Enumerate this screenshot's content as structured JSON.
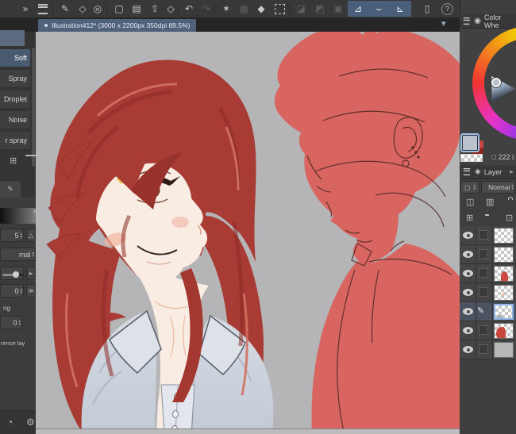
{
  "toolbar": {
    "icons": [
      {
        "name": "panel-overflow",
        "glyph": "»"
      },
      {
        "name": "main-menu",
        "glyph": ""
      },
      {
        "name": "edit-in-app",
        "glyph": "✎"
      },
      {
        "name": "window-size",
        "glyph": "◇"
      },
      {
        "name": "clip-studio-home",
        "glyph": "◎"
      },
      {
        "name": "new-file",
        "glyph": "▢"
      },
      {
        "name": "open-file",
        "glyph": "▤"
      },
      {
        "name": "save-file",
        "glyph": "⇧"
      },
      {
        "name": "export",
        "glyph": "◇"
      },
      {
        "name": "undo",
        "glyph": "↶"
      },
      {
        "name": "redo",
        "glyph": "↷"
      },
      {
        "name": "clear",
        "glyph": "✶"
      },
      {
        "name": "grid",
        "glyph": "▦"
      },
      {
        "name": "fill",
        "glyph": "◆"
      },
      {
        "name": "transform-frame",
        "glyph": ""
      },
      {
        "name": "select-area",
        "glyph": "◪"
      },
      {
        "name": "deselect",
        "glyph": "◩"
      },
      {
        "name": "invert-selection",
        "glyph": "▣"
      },
      {
        "name": "snap-to-ruler",
        "glyph": "⊿"
      },
      {
        "name": "snap-to-special-ruler",
        "glyph": "⌣"
      },
      {
        "name": "snap-to-grid",
        "glyph": "⊾"
      },
      {
        "name": "companion-mode",
        "glyph": "▯"
      },
      {
        "name": "help",
        "glyph": "?"
      }
    ]
  },
  "tab": {
    "title": "Illustration412* (3000 x 2200px 350dpi 89.5%)"
  },
  "subtools": {
    "selected": "Soft",
    "items": [
      {
        "label": "Soft"
      },
      {
        "label": "Spray"
      },
      {
        "label": "Droplet"
      },
      {
        "label": "Noise"
      },
      {
        "label": "r spray"
      }
    ]
  },
  "tool_property": {
    "brush_size_value": "5",
    "blend_value": "mal",
    "density_value": "0",
    "label_partial_1": "ng",
    "spin_value_2": "0",
    "label_partial_2": "rence lay",
    "size_button": "△",
    "slider_button": "▸",
    "more_button": "≫"
  },
  "color_wheel": {
    "title": "Color Whe",
    "rgb_value": "222",
    "primary_color": "#b9c2cd",
    "secondary_color": "#c23b32"
  },
  "layer_panel": {
    "title": "Layer",
    "blend_mode": "Normal",
    "rows": [
      {
        "thumb": "empty",
        "visible": true
      },
      {
        "thumb": "empty",
        "visible": true
      },
      {
        "thumb": "figure",
        "visible": true
      },
      {
        "thumb": "faint",
        "visible": true
      },
      {
        "thumb": "sketch",
        "visible": true,
        "selected": true
      },
      {
        "thumb": "hair",
        "visible": true
      },
      {
        "thumb": "paper",
        "visible": true
      }
    ]
  },
  "canvas": {
    "colors": {
      "background": "#b5b5b8",
      "silhouette_red": "#d8655f",
      "hair_red": "#a83b34",
      "hair_shadow": "#8d2c26",
      "skin": "#f9ece2",
      "shirt": "#ccd3dd",
      "sketch_line": "#4f2622"
    }
  }
}
